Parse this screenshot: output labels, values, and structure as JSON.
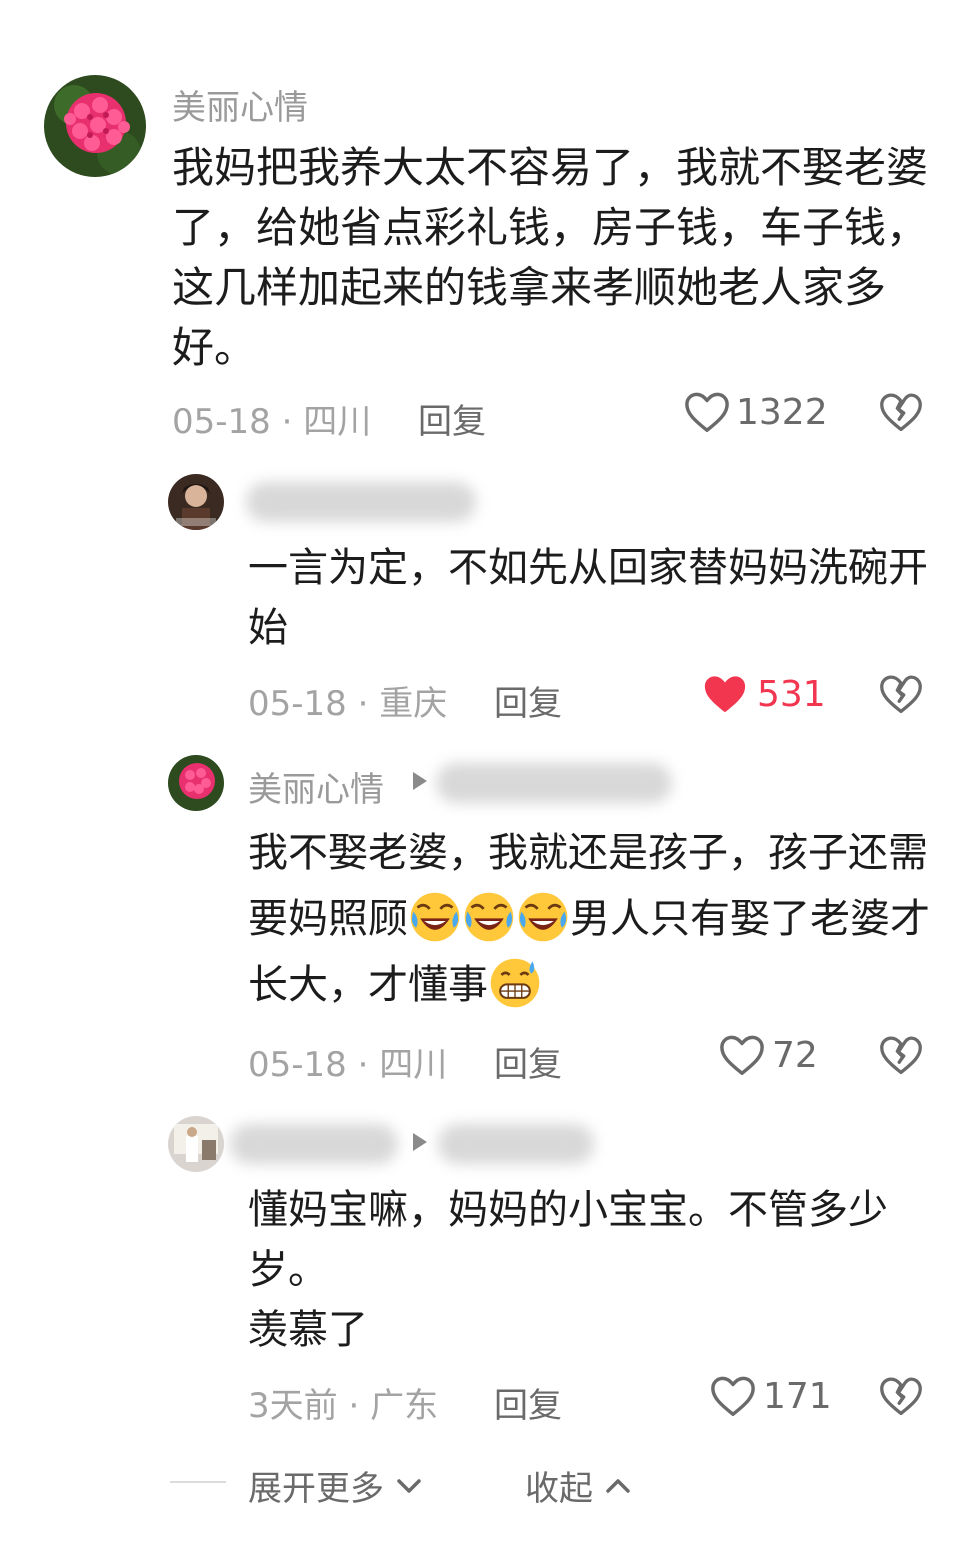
{
  "comments": [
    {
      "author": "美丽心情",
      "text": "我妈把我养大太不容易了，我就不娶老婆了，给她省点彩礼钱，房子钱，车子钱，这几样加起来的钱拿来孝顺她老人家多好。",
      "date": "05-18",
      "location": "四川",
      "reply_label": "回复",
      "likes": "1322",
      "liked": false
    },
    {
      "text": "一言为定，不如先从回家替妈妈洗碗开始",
      "date": "05-18",
      "location": "重庆",
      "reply_label": "回复",
      "likes": "531",
      "liked": true
    },
    {
      "author": "美丽心情",
      "text_part1": "我不娶老婆，我就还是孩子，孩子还需要妈照顾",
      "text_part2": "男人只有娶了老婆才长大，才懂事",
      "date": "05-18",
      "location": "四川",
      "reply_label": "回复",
      "likes": "72",
      "liked": false
    },
    {
      "text": "懂妈宝嘛，妈妈的小宝宝。不管多少岁。\n羡慕了",
      "date": "3天前",
      "location": "广东",
      "reply_label": "回复",
      "likes": "171",
      "liked": false
    }
  ],
  "footer": {
    "expand_label": "展开更多",
    "collapse_label": "收起"
  },
  "colors": {
    "liked": "#f2364f",
    "meta": "#a3a3a3",
    "icon": "#6a6a6a"
  }
}
